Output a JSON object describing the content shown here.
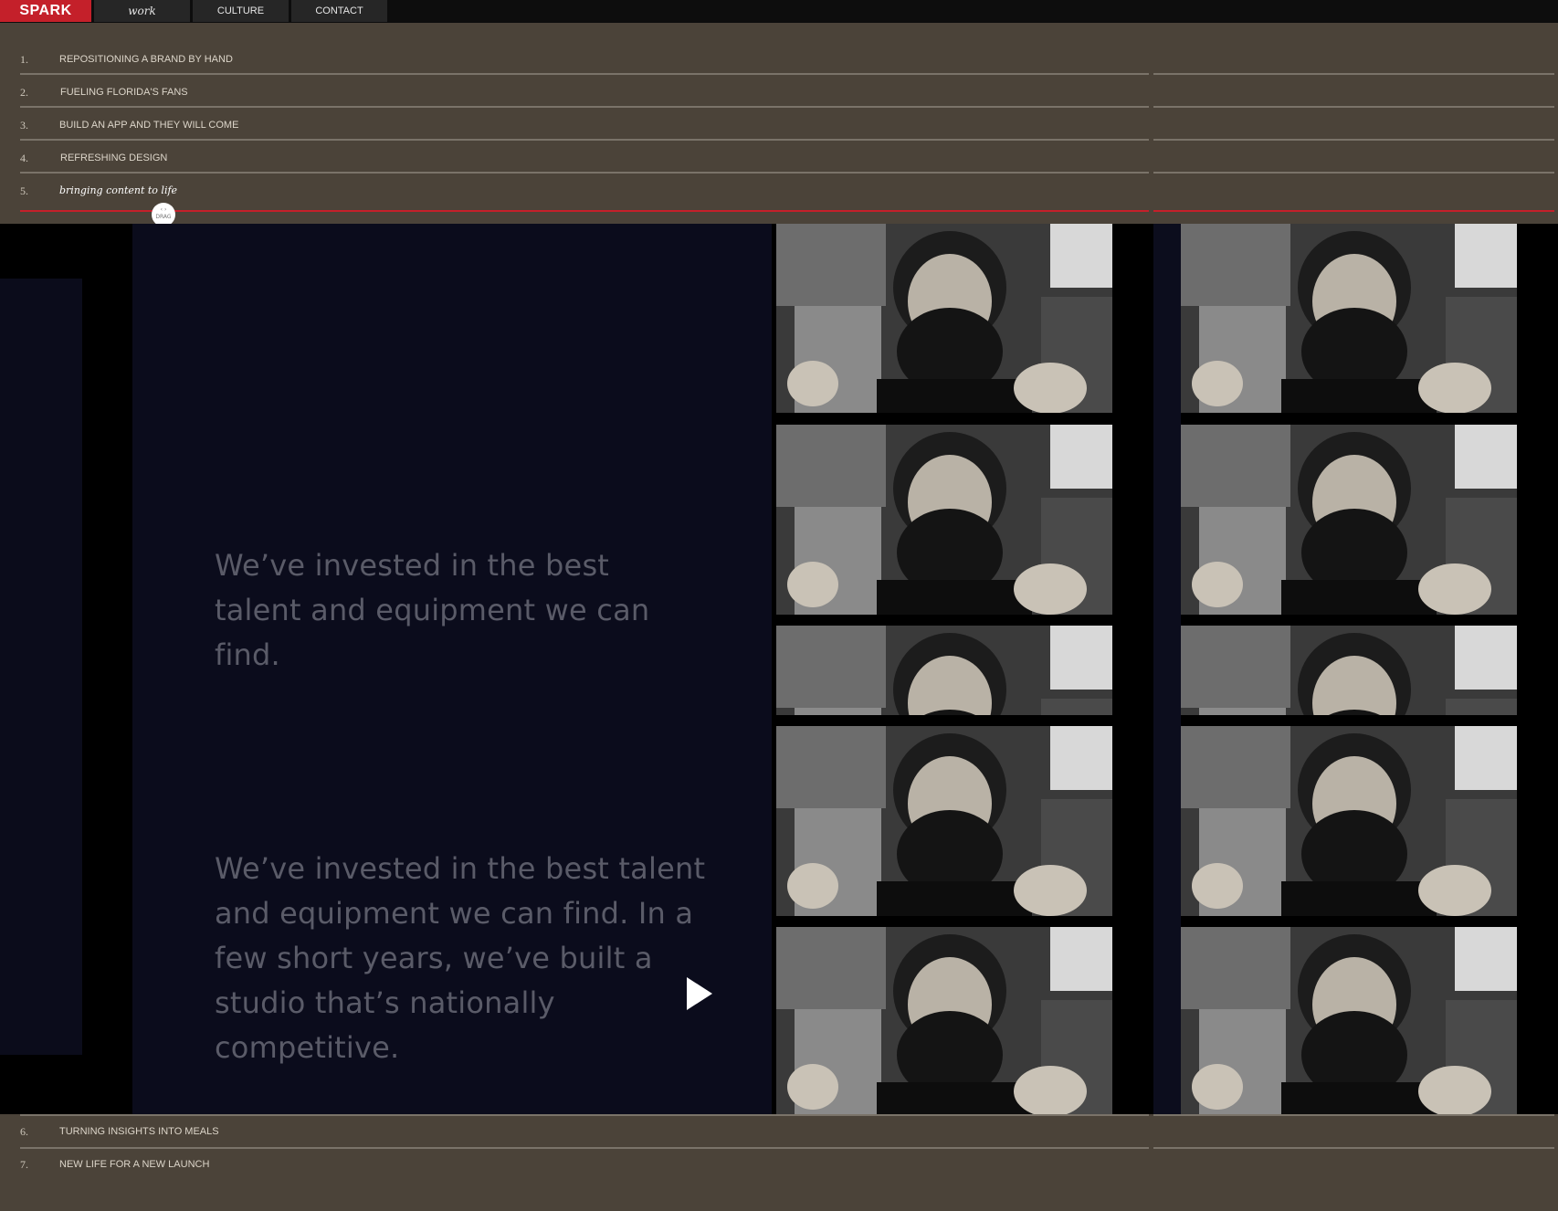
{
  "nav": {
    "logo": "SPARK",
    "work": "work",
    "culture": "CULTURE",
    "contact": "CONTACT"
  },
  "projects_top": [
    {
      "num": "1.",
      "title": "REPOSITIONING A BRAND BY HAND"
    },
    {
      "num": "2.",
      "title": "FUELING FLORIDA'S FANS"
    },
    {
      "num": "3.",
      "title": "BUILD AN APP AND THEY WILL COME"
    },
    {
      "num": "4.",
      "title": "REFRESHING DESIGN"
    },
    {
      "num": "5.",
      "title": "bringing content to life"
    }
  ],
  "drag_label": "DRAG",
  "quote1": "We’ve invested in the best talent and equipment we can find.",
  "quote2": "We’ve invested in the best talent and equipment we can find. In a few short years, we’ve built a studio that’s nationally competitive.",
  "projects_bottom": [
    {
      "num": "6.",
      "title": "TURNING INSIGHTS INTO MEALS"
    },
    {
      "num": "7.",
      "title": "NEW LIFE FOR A NEW LAUNCH"
    }
  ],
  "colors": {
    "brand_red": "#c4202a",
    "paper": "#4b4339",
    "panel": "#0b0c1c"
  }
}
